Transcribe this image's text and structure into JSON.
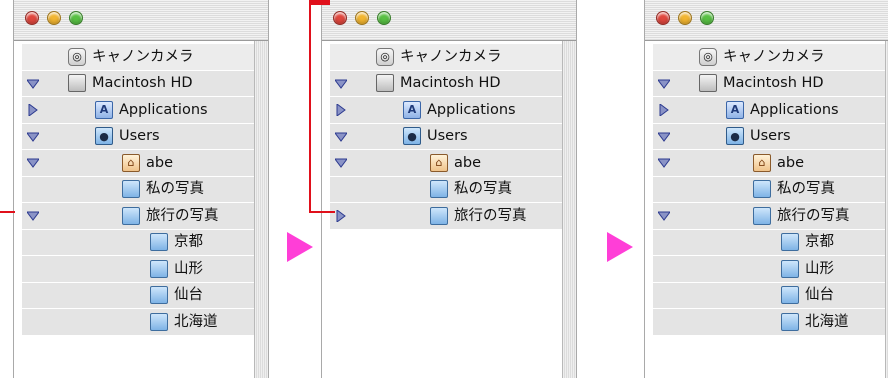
{
  "accent_color": "#ff3ed7",
  "callout_color": "#e0101b",
  "windows": [
    {
      "rows": [
        {
          "label": "キャノンカメラ",
          "icon": "camera-icon",
          "indent": 46,
          "tri": "none"
        },
        {
          "label": "Macintosh HD",
          "icon": "disk-icon",
          "indent": 46,
          "tri": "down"
        },
        {
          "label": "Applications",
          "icon": "applications-folder-icon",
          "indent": 73,
          "tri": "right"
        },
        {
          "label": "Users",
          "icon": "users-folder-icon",
          "indent": 73,
          "tri": "down"
        },
        {
          "label": "abe",
          "icon": "home-folder-icon",
          "indent": 100,
          "tri": "down"
        },
        {
          "label": "私の写真",
          "icon": "folder-icon",
          "indent": 100,
          "tri": "none"
        },
        {
          "label": "旅行の写真",
          "icon": "folder-icon",
          "indent": 100,
          "tri": "down"
        },
        {
          "label": "京都",
          "icon": "folder-icon",
          "indent": 128,
          "tri": "none"
        },
        {
          "label": "山形",
          "icon": "folder-icon",
          "indent": 128,
          "tri": "none"
        },
        {
          "label": "仙台",
          "icon": "folder-icon",
          "indent": 128,
          "tri": "none"
        },
        {
          "label": "北海道",
          "icon": "folder-icon",
          "indent": 128,
          "tri": "none"
        }
      ]
    },
    {
      "rows": [
        {
          "label": "キャノンカメラ",
          "icon": "camera-icon",
          "indent": 46,
          "tri": "none"
        },
        {
          "label": "Macintosh HD",
          "icon": "disk-icon",
          "indent": 46,
          "tri": "down"
        },
        {
          "label": "Applications",
          "icon": "applications-folder-icon",
          "indent": 73,
          "tri": "right"
        },
        {
          "label": "Users",
          "icon": "users-folder-icon",
          "indent": 73,
          "tri": "down"
        },
        {
          "label": "abe",
          "icon": "home-folder-icon",
          "indent": 100,
          "tri": "down"
        },
        {
          "label": "私の写真",
          "icon": "folder-icon",
          "indent": 100,
          "tri": "none"
        },
        {
          "label": "旅行の写真",
          "icon": "folder-icon",
          "indent": 100,
          "tri": "right"
        }
      ]
    },
    {
      "rows": [
        {
          "label": "キャノンカメラ",
          "icon": "camera-icon",
          "indent": 46,
          "tri": "none"
        },
        {
          "label": "Macintosh HD",
          "icon": "disk-icon",
          "indent": 46,
          "tri": "down"
        },
        {
          "label": "Applications",
          "icon": "applications-folder-icon",
          "indent": 73,
          "tri": "right"
        },
        {
          "label": "Users",
          "icon": "users-folder-icon",
          "indent": 73,
          "tri": "down"
        },
        {
          "label": "abe",
          "icon": "home-folder-icon",
          "indent": 100,
          "tri": "down"
        },
        {
          "label": "私の写真",
          "icon": "folder-icon",
          "indent": 100,
          "tri": "none"
        },
        {
          "label": "旅行の写真",
          "icon": "folder-icon",
          "indent": 100,
          "tri": "down"
        },
        {
          "label": "京都",
          "icon": "folder-icon",
          "indent": 128,
          "tri": "none"
        },
        {
          "label": "山形",
          "icon": "folder-icon",
          "indent": 128,
          "tri": "none"
        },
        {
          "label": "仙台",
          "icon": "folder-icon",
          "indent": 128,
          "tri": "none"
        },
        {
          "label": "北海道",
          "icon": "folder-icon",
          "indent": 128,
          "tri": "none"
        }
      ]
    }
  ]
}
